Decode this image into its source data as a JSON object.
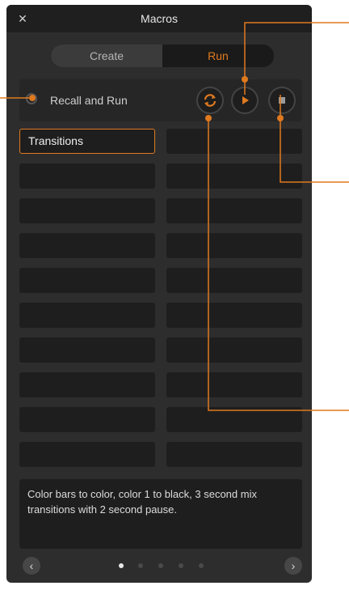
{
  "window": {
    "title": "Macros",
    "close_symbol": "✕"
  },
  "tabs": {
    "create_label": "Create",
    "run_label": "Run",
    "active": "Run"
  },
  "recall": {
    "label": "Recall and Run",
    "checked": false
  },
  "controls": {
    "loop_icon": "loop-icon",
    "play_icon": "play-icon",
    "stop_icon": "stop-icon"
  },
  "macro_grid": {
    "columns": 2,
    "rows": 10,
    "slots": [
      {
        "label": "Transitions",
        "selected": true
      }
    ]
  },
  "description": {
    "text": "Color bars to color, color 1 to black, 3 second mix transitions with 2 second pause."
  },
  "pagination": {
    "prev_symbol": "‹",
    "next_symbol": "›",
    "page_count": 5,
    "current_page": 1
  },
  "colors": {
    "accent": "#e07a1f",
    "panel": "#2d2d2d",
    "slot": "#1e1e1e"
  }
}
